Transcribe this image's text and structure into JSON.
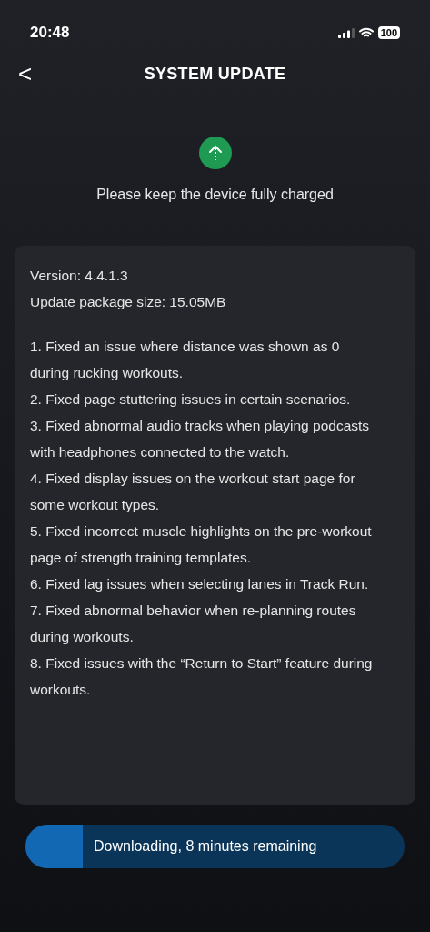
{
  "status_bar": {
    "time": "20:48",
    "battery": "100"
  },
  "header": {
    "back": "<",
    "title": "SYSTEM UPDATE"
  },
  "notice": "Please keep the device fully charged",
  "card": {
    "version": "Version: 4.4.1.3",
    "size": "Update package size: 15.05MB",
    "notes": [
      "1. Fixed an issue where distance was shown as 0 during rucking workouts.",
      "2. Fixed page stuttering issues in certain scenarios.",
      "3. Fixed abnormal audio tracks when playing podcasts with headphones connected to the watch.",
      "4. Fixed display issues on the workout start page for some workout types.",
      "5. Fixed incorrect muscle highlights on the pre-workout page of strength training templates.",
      "6. Fixed lag issues when selecting lanes in Track Run.",
      "7. Fixed abnormal behavior when re-planning routes during workouts.",
      "8. Fixed issues with the “Return to Start” feature during workouts."
    ]
  },
  "progress": {
    "label": "Downloading, 8 minutes remaining",
    "level": 0.15
  }
}
